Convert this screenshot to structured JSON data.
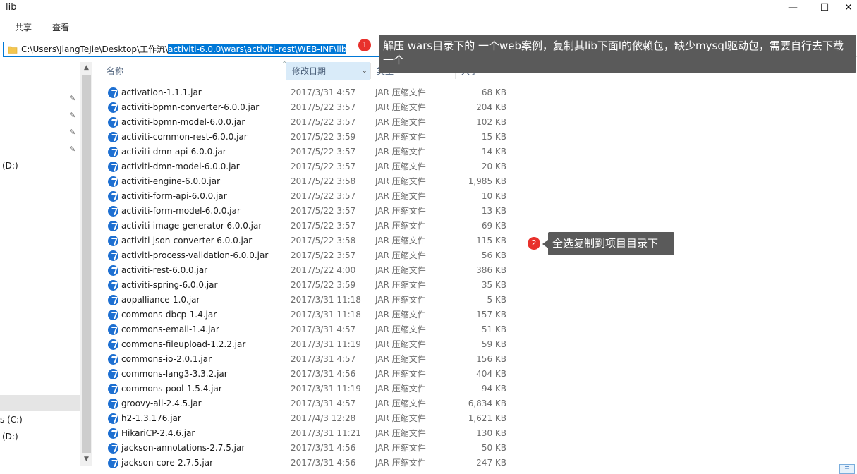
{
  "window": {
    "title": "lib",
    "minimize": "—",
    "maximize": "☐",
    "close": "✕"
  },
  "ribbon": {
    "tabs": [
      "共享",
      "查看"
    ]
  },
  "address": {
    "prefix": "C:\\Users\\JiangTeJie\\Desktop\\工作流\\",
    "selected": "activiti-6.0.0\\wars\\activiti-rest\\WEB-INF\\lib",
    "refresh_icon": "refresh-icon",
    "search_glyph": "⌕"
  },
  "nav": {
    "drive_top": "(D:)",
    "drive_c": "s (C:)",
    "drive_d": "(D:)",
    "pin_glyph": "📌"
  },
  "columns": {
    "name": "名称",
    "date": "修改日期",
    "type": "类型",
    "size": "大小"
  },
  "files": [
    {
      "name": "activation-1.1.1.jar",
      "date": "2017/3/31 4:57",
      "type": "JAR 压缩文件",
      "size": "68 KB"
    },
    {
      "name": "activiti-bpmn-converter-6.0.0.jar",
      "date": "2017/5/22 3:57",
      "type": "JAR 压缩文件",
      "size": "204 KB"
    },
    {
      "name": "activiti-bpmn-model-6.0.0.jar",
      "date": "2017/5/22 3:57",
      "type": "JAR 压缩文件",
      "size": "102 KB"
    },
    {
      "name": "activiti-common-rest-6.0.0.jar",
      "date": "2017/5/22 3:59",
      "type": "JAR 压缩文件",
      "size": "15 KB"
    },
    {
      "name": "activiti-dmn-api-6.0.0.jar",
      "date": "2017/5/22 3:57",
      "type": "JAR 压缩文件",
      "size": "14 KB"
    },
    {
      "name": "activiti-dmn-model-6.0.0.jar",
      "date": "2017/5/22 3:57",
      "type": "JAR 压缩文件",
      "size": "20 KB"
    },
    {
      "name": "activiti-engine-6.0.0.jar",
      "date": "2017/5/22 3:58",
      "type": "JAR 压缩文件",
      "size": "1,985 KB"
    },
    {
      "name": "activiti-form-api-6.0.0.jar",
      "date": "2017/5/22 3:57",
      "type": "JAR 压缩文件",
      "size": "10 KB"
    },
    {
      "name": "activiti-form-model-6.0.0.jar",
      "date": "2017/5/22 3:57",
      "type": "JAR 压缩文件",
      "size": "13 KB"
    },
    {
      "name": "activiti-image-generator-6.0.0.jar",
      "date": "2017/5/22 3:57",
      "type": "JAR 压缩文件",
      "size": "69 KB"
    },
    {
      "name": "activiti-json-converter-6.0.0.jar",
      "date": "2017/5/22 3:58",
      "type": "JAR 压缩文件",
      "size": "115 KB"
    },
    {
      "name": "activiti-process-validation-6.0.0.jar",
      "date": "2017/5/22 3:57",
      "type": "JAR 压缩文件",
      "size": "56 KB"
    },
    {
      "name": "activiti-rest-6.0.0.jar",
      "date": "2017/5/22 4:00",
      "type": "JAR 压缩文件",
      "size": "386 KB"
    },
    {
      "name": "activiti-spring-6.0.0.jar",
      "date": "2017/5/22 3:59",
      "type": "JAR 压缩文件",
      "size": "35 KB"
    },
    {
      "name": "aopalliance-1.0.jar",
      "date": "2017/3/31 11:18",
      "type": "JAR 压缩文件",
      "size": "5 KB"
    },
    {
      "name": "commons-dbcp-1.4.jar",
      "date": "2017/3/31 11:18",
      "type": "JAR 压缩文件",
      "size": "157 KB"
    },
    {
      "name": "commons-email-1.4.jar",
      "date": "2017/3/31 4:57",
      "type": "JAR 压缩文件",
      "size": "51 KB"
    },
    {
      "name": "commons-fileupload-1.2.2.jar",
      "date": "2017/3/31 11:19",
      "type": "JAR 压缩文件",
      "size": "59 KB"
    },
    {
      "name": "commons-io-2.0.1.jar",
      "date": "2017/3/31 4:57",
      "type": "JAR 压缩文件",
      "size": "156 KB"
    },
    {
      "name": "commons-lang3-3.3.2.jar",
      "date": "2017/3/31 4:56",
      "type": "JAR 压缩文件",
      "size": "404 KB"
    },
    {
      "name": "commons-pool-1.5.4.jar",
      "date": "2017/3/31 11:19",
      "type": "JAR 压缩文件",
      "size": "94 KB"
    },
    {
      "name": "groovy-all-2.4.5.jar",
      "date": "2017/3/31 4:57",
      "type": "JAR 压缩文件",
      "size": "6,834 KB"
    },
    {
      "name": "h2-1.3.176.jar",
      "date": "2017/4/3 12:28",
      "type": "JAR 压缩文件",
      "size": "1,621 KB"
    },
    {
      "name": "HikariCP-2.4.6.jar",
      "date": "2017/3/31 11:21",
      "type": "JAR 压缩文件",
      "size": "130 KB"
    },
    {
      "name": "jackson-annotations-2.7.5.jar",
      "date": "2017/3/31 4:56",
      "type": "JAR 压缩文件",
      "size": "50 KB"
    },
    {
      "name": "jackson-core-2.7.5.jar",
      "date": "2017/3/31 4:56",
      "type": "JAR 压缩文件",
      "size": "247 KB"
    }
  ],
  "callouts": {
    "one": {
      "badge": "1",
      "text": "解压 wars目录下的 一个web案例，复制其lib下面l的依赖包，缺少mysql驱动包，需要自行去下载一个"
    },
    "two": {
      "badge": "2",
      "text": "全选复制到项目目录下"
    }
  },
  "icons": {
    "file": "jar-file-icon",
    "folder": "folder-icon"
  },
  "colors": {
    "accent": "#0078d7",
    "badge": "#e8312c",
    "callout_bg": "#5a5a5a",
    "sorted_header_bg": "#d9ebf9"
  }
}
